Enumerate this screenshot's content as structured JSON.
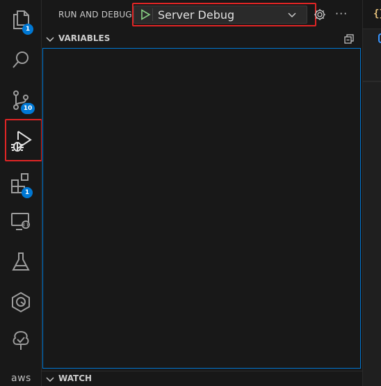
{
  "activity_bar": {
    "items": [
      {
        "name": "explorer",
        "icon": "files-icon",
        "badge": "1"
      },
      {
        "name": "search",
        "icon": "search-icon",
        "badge": ""
      },
      {
        "name": "source-control",
        "icon": "source-control-icon",
        "badge": "10"
      },
      {
        "name": "run-and-debug",
        "icon": "run-debug-icon",
        "badge": "",
        "active": true
      },
      {
        "name": "extensions",
        "icon": "extensions-icon",
        "badge": "1"
      },
      {
        "name": "remote-explorer",
        "icon": "remote-explorer-icon",
        "badge": ""
      },
      {
        "name": "testing",
        "icon": "flask-icon",
        "badge": ""
      },
      {
        "name": "hexagon-extension",
        "icon": "hexagon-icon",
        "badge": ""
      },
      {
        "name": "tree-extension",
        "icon": "tree-icon",
        "badge": ""
      },
      {
        "name": "aws-toolkit",
        "icon": "aws-icon",
        "badge": ""
      }
    ],
    "aws_label": "aws"
  },
  "panel": {
    "title": "RUN AND DEBUG",
    "configuration": "Server Debug",
    "sections": {
      "variables": "VARIABLES",
      "watch": "WATCH"
    }
  },
  "editor": {
    "tab_icon_text": "{}"
  },
  "colors": {
    "accent": "#0078d4",
    "highlight": "#e02525",
    "play": "#89d185"
  }
}
